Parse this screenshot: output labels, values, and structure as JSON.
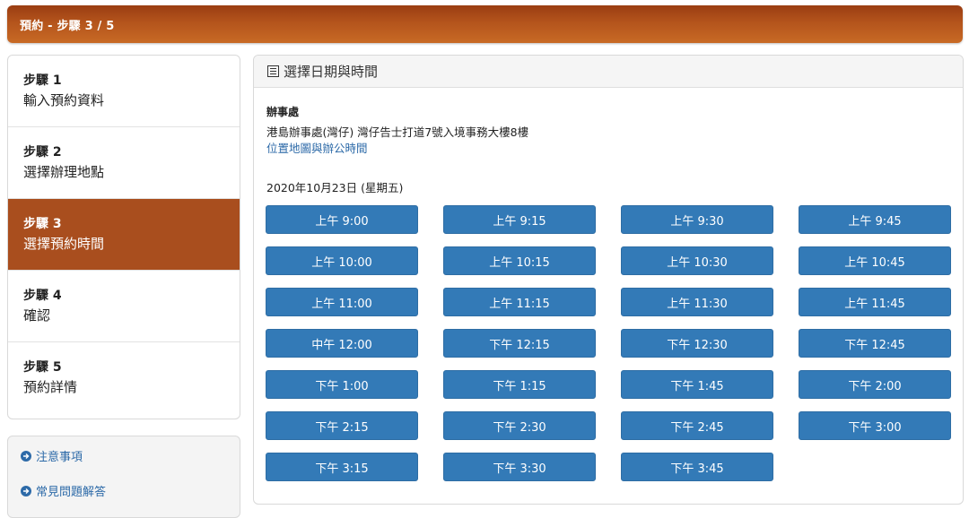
{
  "header": {
    "title": "預約 - 步驟 3 / 5"
  },
  "steps": [
    {
      "num": "步驟 1",
      "label": "輸入預約資料",
      "active": false
    },
    {
      "num": "步驟 2",
      "label": "選擇辦理地點",
      "active": false
    },
    {
      "num": "步驟 3",
      "label": "選擇預約時間",
      "active": true
    },
    {
      "num": "步驟 4",
      "label": "確認",
      "active": false
    },
    {
      "num": "步驟 5",
      "label": "預約詳情",
      "active": false
    }
  ],
  "links": [
    {
      "label": "注意事項",
      "icon": "circle-arrow-right-icon"
    },
    {
      "label": "常見問題解答",
      "icon": "circle-arrow-right-icon"
    }
  ],
  "panel": {
    "title": "選擇日期與時間",
    "icon": "document-list-icon",
    "office_label": "辦事處",
    "office_address": "港島辦事處(灣仔) 灣仔告士打道7號入境事務大樓8樓",
    "office_link": "位置地圖與辦公時間",
    "date": "2020年10月23日 (星期五)"
  },
  "slots": [
    "上午 9:00",
    "上午 9:15",
    "上午 9:30",
    "上午 9:45",
    "上午 10:00",
    "上午 10:15",
    "上午 10:30",
    "上午 10:45",
    "上午 11:00",
    "上午 11:15",
    "上午 11:30",
    "上午 11:45",
    "中午 12:00",
    "下午 12:15",
    "下午 12:30",
    "下午 12:45",
    "下午 1:00",
    "下午 1:15",
    "下午 1:45",
    "下午 2:00",
    "下午 2:15",
    "下午 2:30",
    "下午 2:45",
    "下午 3:00",
    "下午 3:15",
    "下午 3:30",
    "下午 3:45"
  ],
  "colors": {
    "header_gradient_start": "#9a3d12",
    "header_gradient_end": "#c86a25",
    "active_step": "#a94e1e",
    "slot_button": "#337ab7",
    "link": "#2d6aa8"
  }
}
